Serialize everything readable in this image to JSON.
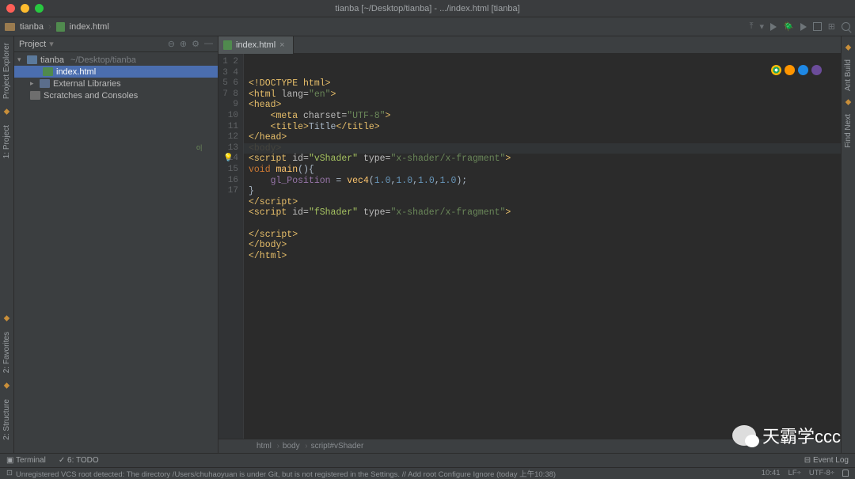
{
  "window": {
    "title": "tianba [~/Desktop/tianba] - .../index.html [tianba]"
  },
  "nav": {
    "folder": "tianba",
    "file": "index.html"
  },
  "sidebar": {
    "panel_title": "Project",
    "root": {
      "name": "tianba",
      "hint": "~/Desktop/tianba"
    },
    "file": "index.html",
    "ext_lib": "External Libraries",
    "scratch": "Scratches and Consoles"
  },
  "rails": {
    "left_top": "Project Explorer",
    "left_p1": "1: Project",
    "left_p2": "2: Favorites",
    "left_p3": "2: Structure",
    "right_top": "Ant Build",
    "right_p1": "Find Next"
  },
  "tab": {
    "name": "index.html"
  },
  "code": {
    "lines": [
      "1",
      "2",
      "3",
      "4",
      "5",
      "6",
      "7",
      "8",
      "9",
      "10",
      "11",
      "12",
      "13",
      "14",
      "15",
      "16",
      "17"
    ],
    "l1": "<!DOCTYPE html>",
    "l2a": "<html ",
    "l2b": "lang=",
    "l2c": "\"en\"",
    "l2d": ">",
    "l3": "<head>",
    "l4a": "    <meta ",
    "l4b": "charset=",
    "l4c": "\"UTF-8\"",
    "l4d": ">",
    "l5a": "    <title>",
    "l5b": "Title",
    "l5c": "</title>",
    "l6": "</head>",
    "l7": "<body>",
    "l8a": "<script ",
    "l8b": "id=",
    "l8c": "\"vShader\" ",
    "l8d": "type=",
    "l8e": "\"x-shader/x-fragment\"",
    "l8f": ">",
    "l9a": "void ",
    "l9b": "main",
    "l9c": "(){",
    "l10a": "    gl_Position",
    "l10b": " = ",
    "l10c": "vec4",
    "l10d": "(",
    "l10e": "1.0",
    "l10f": ",",
    "l10g": "1.0",
    "l10h": ",",
    "l10i": "1.0",
    "l10j": ",",
    "l10k": "1.0",
    "l10l": ");",
    "l11": "}",
    "l12": "</script>",
    "l13a": "<script ",
    "l13b": "id=",
    "l13c": "\"fShader\" ",
    "l13d": "type=",
    "l13e": "\"x-shader/x-fragment\"",
    "l13f": ">",
    "l14": "",
    "l15": "</script>",
    "l16": "</body>",
    "l17": "</html>"
  },
  "breadcrumb": {
    "b1": "html",
    "b2": "body",
    "b3": "script#vShader"
  },
  "bottom": {
    "terminal": "Terminal",
    "todo": "6: TODO",
    "eventlog": "Event Log"
  },
  "status": {
    "msg": "Unregistered VCS root detected: The directory /Users/chuhaoyuan is under Git, but is not registered in the Settings. // Add root  Configure  Ignore (today 上午10:38)",
    "caret": "10:41",
    "lf": "LF÷",
    "enc": "UTF-8÷"
  },
  "watermark": "天霸学ccc"
}
